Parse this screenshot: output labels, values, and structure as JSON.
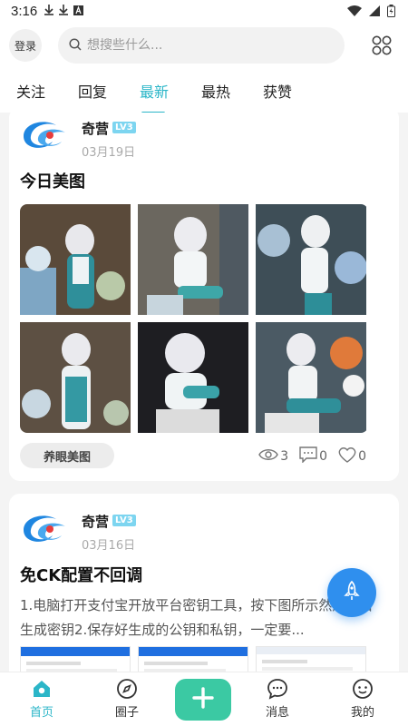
{
  "status": {
    "time": "3:16"
  },
  "topbar": {
    "login_label": "登录",
    "search_placeholder": "想搜些什么..."
  },
  "tabs": [
    {
      "label": "关注"
    },
    {
      "label": "回复"
    },
    {
      "label": "最新"
    },
    {
      "label": "最热"
    },
    {
      "label": "获赞"
    }
  ],
  "active_tab": "最新",
  "posts": [
    {
      "author": "奇营",
      "level": "LV3",
      "date": "03月19日",
      "title": "今日美图",
      "tag": "养眼美图",
      "views": "3",
      "comments": "0",
      "likes": "0"
    },
    {
      "author": "奇营",
      "level": "LV3",
      "date": "03月16日",
      "title": "免CK配置不回调",
      "body": "1.电脑打开支付宝开放平台密钥工具，按下图所示然后点击生成密钥2.保存好生成的公钥和私钥，一定要..."
    }
  ],
  "bottom_nav": [
    {
      "label": "首页",
      "icon": "home-icon"
    },
    {
      "label": "圈子",
      "icon": "compass-icon"
    },
    {
      "label": "消息",
      "icon": "message-icon"
    },
    {
      "label": "我的",
      "icon": "profile-icon"
    }
  ],
  "colors": {
    "accent": "#2bb6c8",
    "post_button": "#3bc9a3",
    "fab": "#2f8fee"
  }
}
